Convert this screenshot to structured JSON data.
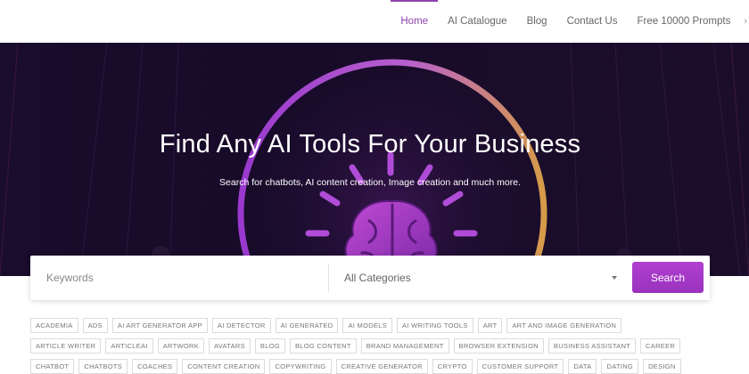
{
  "nav": {
    "items": [
      {
        "label": "Home",
        "active": true
      },
      {
        "label": "AI Catalogue",
        "active": false
      },
      {
        "label": "Blog",
        "active": false
      },
      {
        "label": "Contact Us",
        "active": false
      },
      {
        "label": "Free 10000 Prompts",
        "active": false
      }
    ],
    "more_icon": "chevron-icon"
  },
  "hero": {
    "title": "Find Any AI Tools For Your Business",
    "subtitle": "Search for chatbots, AI content creation, Image creation and much more.",
    "art": "brain-icon"
  },
  "search": {
    "keywords_placeholder": "Keywords",
    "category_selected": "All Categories",
    "button_label": "Search"
  },
  "tags": {
    "rows": [
      [
        "ACADEMIA",
        "ADS",
        "AI ART GENERATOR APP",
        "AI DETECTOR",
        "AI GENERATED",
        "AI MODELS",
        "AI WRITING TOOLS",
        "ART",
        "ART AND IMAGE GENERATION"
      ],
      [
        "ARTICLE WRITER",
        "ARTICLEAI",
        "ARTWORK",
        "AVATARS",
        "BLOG",
        "BLOG CONTENT",
        "BRAND MANAGEMENT",
        "BROWSER EXTENSION",
        "BUSINESS ASSISTANT",
        "CAREER"
      ],
      [
        "CHATBOT",
        "CHATBOTS",
        "COACHES",
        "CONTENT CREATION",
        "COPYWRITING",
        "CREATIVE GENERATOR",
        "CRYPTO",
        "CUSTOMER SUPPORT",
        "DATA",
        "DATING",
        "DESIGN"
      ]
    ]
  },
  "colors": {
    "accent": "#8e44ad",
    "button": "#a53ac8",
    "hero_bg": "#190c2c"
  }
}
